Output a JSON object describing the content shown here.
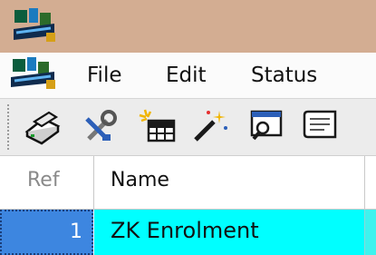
{
  "window": {
    "app_icon": "app-logo-icon"
  },
  "menubar": {
    "app_icon": "app-logo-icon",
    "items": [
      {
        "label": "File"
      },
      {
        "label": "Edit"
      },
      {
        "label": "Status"
      }
    ]
  },
  "toolbar": {
    "buttons": [
      {
        "icon": "scanner-icon"
      },
      {
        "icon": "tools-icon"
      },
      {
        "icon": "new-table-icon"
      },
      {
        "icon": "magic-wand-icon"
      },
      {
        "icon": "search-window-icon"
      },
      {
        "icon": "document-icon"
      }
    ]
  },
  "grid": {
    "columns": [
      {
        "label": "Ref"
      },
      {
        "label": "Name"
      }
    ],
    "rows": [
      {
        "ref": "1",
        "name": "ZK Enrolment"
      }
    ]
  },
  "colors": {
    "titlebar": "#d3ad92",
    "selected_ref": "#3d86e0",
    "selected_row": "#00ffff"
  }
}
